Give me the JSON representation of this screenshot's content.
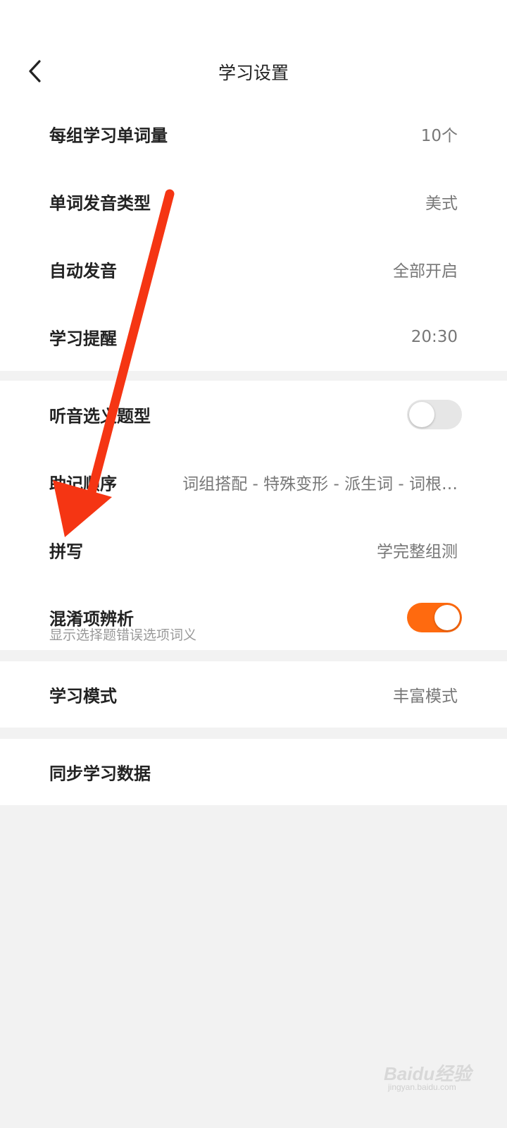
{
  "header": {
    "title": "学习设置",
    "back_icon": "chevron-left-icon"
  },
  "sections": {
    "basic": [
      {
        "label": "每组学习单词量",
        "value": "10个"
      },
      {
        "label": "单词发音类型",
        "value": "美式"
      },
      {
        "label": "自动发音",
        "value": "全部开启"
      },
      {
        "label": "学习提醒",
        "value": "20:30"
      }
    ],
    "practice": {
      "listen_choice": {
        "label": "听音选义题型",
        "toggle_on": false
      },
      "assist_order": {
        "label": "助记顺序",
        "value": "词组搭配 - 特殊变形 - 派生词 - 词根…"
      },
      "spelling": {
        "label": "拼写",
        "value": "学完整组测"
      },
      "confusion": {
        "label": "混淆项辨析",
        "sublabel": "显示选择题错误选项词义",
        "toggle_on": true
      }
    },
    "mode": {
      "label": "学习模式",
      "value": "丰富模式"
    },
    "sync": {
      "label": "同步学习数据"
    }
  },
  "colors": {
    "accent": "#ff6a0f",
    "annotation_arrow": "#f53513"
  },
  "watermark": {
    "logo": "Baidu经验",
    "sub": "jingyan.baidu.com"
  }
}
